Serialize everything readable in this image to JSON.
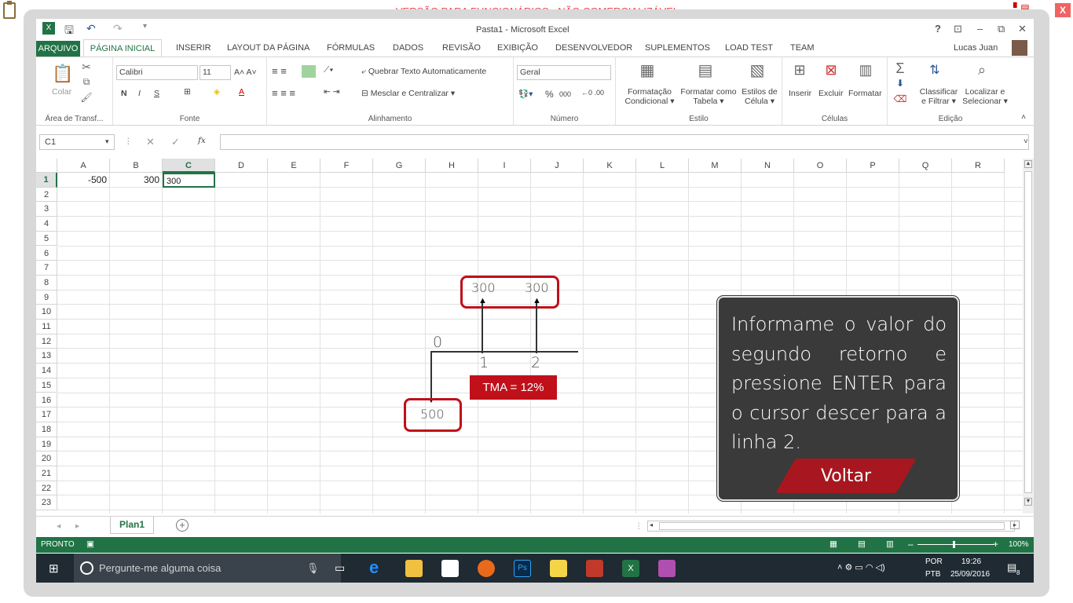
{
  "banner": "VERSÃO PARA FUNCIONÁRIOS - NÃO COMERCIALIZÁVEL",
  "close_x": "X",
  "window": {
    "title": "Pasta1 - Microsoft Excel",
    "help": "?"
  },
  "tabs": [
    "ARQUIVO",
    "PÁGINA INICIAL",
    "INSERIR",
    "LAYOUT DA PÁGINA",
    "FÓRMULAS",
    "DADOS",
    "REVISÃO",
    "EXIBIÇÃO",
    "DESENVOLVEDOR",
    "SUPLEMENTOS",
    "LOAD TEST",
    "TEAM"
  ],
  "user": "Lucas Juan",
  "ribbon": {
    "clipboard": {
      "paste": "Colar",
      "label": "Área de Transf..."
    },
    "font": {
      "name": "Calibri",
      "size": "11",
      "label": "Fonte",
      "bold": "N",
      "italic": "I",
      "underline": "S"
    },
    "alignment": {
      "wrap": "Quebrar Texto Automaticamente",
      "merge": "Mesclar e Centralizar",
      "label": "Alinhamento"
    },
    "number": {
      "format": "Geral",
      "label": "Número",
      "percent": "%",
      "thousands": "000"
    },
    "styles": {
      "cond": [
        "Formatação",
        "Condicional"
      ],
      "table": [
        "Formatar como",
        "Tabela"
      ],
      "cell": [
        "Estilos de",
        "Célula"
      ],
      "label": "Estilo"
    },
    "cells": {
      "insert": "Inserir",
      "delete": "Excluir",
      "format": "Formatar",
      "label": "Células"
    },
    "editing": {
      "sort": [
        "Classificar",
        "e Filtrar"
      ],
      "find": [
        "Localizar e",
        "Selecionar"
      ],
      "label": "Edição"
    }
  },
  "formula_bar": {
    "name_box": "C1",
    "fx": "fx",
    "content": ""
  },
  "columns": [
    "A",
    "B",
    "C",
    "D",
    "E",
    "F",
    "G",
    "H",
    "I",
    "J",
    "K",
    "L",
    "M",
    "N",
    "O",
    "P",
    "Q",
    "R"
  ],
  "rows": [
    "1",
    "2",
    "3",
    "4",
    "5",
    "6",
    "7",
    "8",
    "9",
    "10",
    "11",
    "12",
    "13",
    "14",
    "15",
    "16",
    "17",
    "18",
    "19",
    "20",
    "21",
    "22",
    "23"
  ],
  "cells": {
    "A1": "-500",
    "B1": "300",
    "C1": "300"
  },
  "sheet": {
    "tab": "Plan1",
    "add": "+"
  },
  "status": {
    "mode": "PRONTO",
    "zoom": "100%"
  },
  "diagram": {
    "top_values": [
      "300",
      "300"
    ],
    "period_0": "0",
    "period_1": "1",
    "period_2": "2",
    "rate": "TMA = 12%",
    "bottom_value": "500"
  },
  "popup": {
    "message": "Informame o valor do segundo retorno e pressione ENTER para o cursor descer para a linha 2.",
    "button": "Voltar"
  },
  "taskbar": {
    "search_placeholder": "Pergunte-me alguma coisa",
    "lang": [
      "POR",
      "PTB"
    ],
    "time": "19:26",
    "date": "25/09/2016",
    "notifications": "8"
  }
}
